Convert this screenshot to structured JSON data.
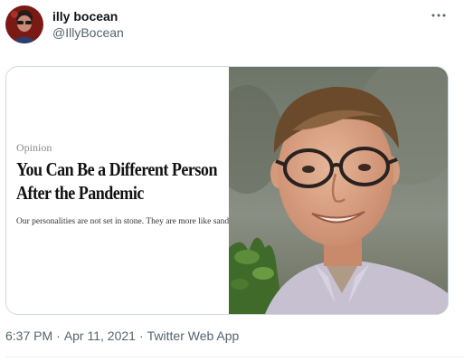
{
  "author": {
    "display_name": "illy bocean",
    "handle": "@IllyBocean"
  },
  "media": {
    "article": {
      "section": "Opinion",
      "headline": "You Can Be a Different Person After the Pandemic",
      "summary": "Our personalities are not set in stone. They are more like sand dunes."
    }
  },
  "meta": {
    "time": "6:37 PM",
    "separator": "·",
    "date": "Apr 11, 2021",
    "source": "Twitter Web App"
  },
  "colors": {
    "text_primary": "#0f1419",
    "text_secondary": "#536471",
    "border": "#cfd9de"
  }
}
